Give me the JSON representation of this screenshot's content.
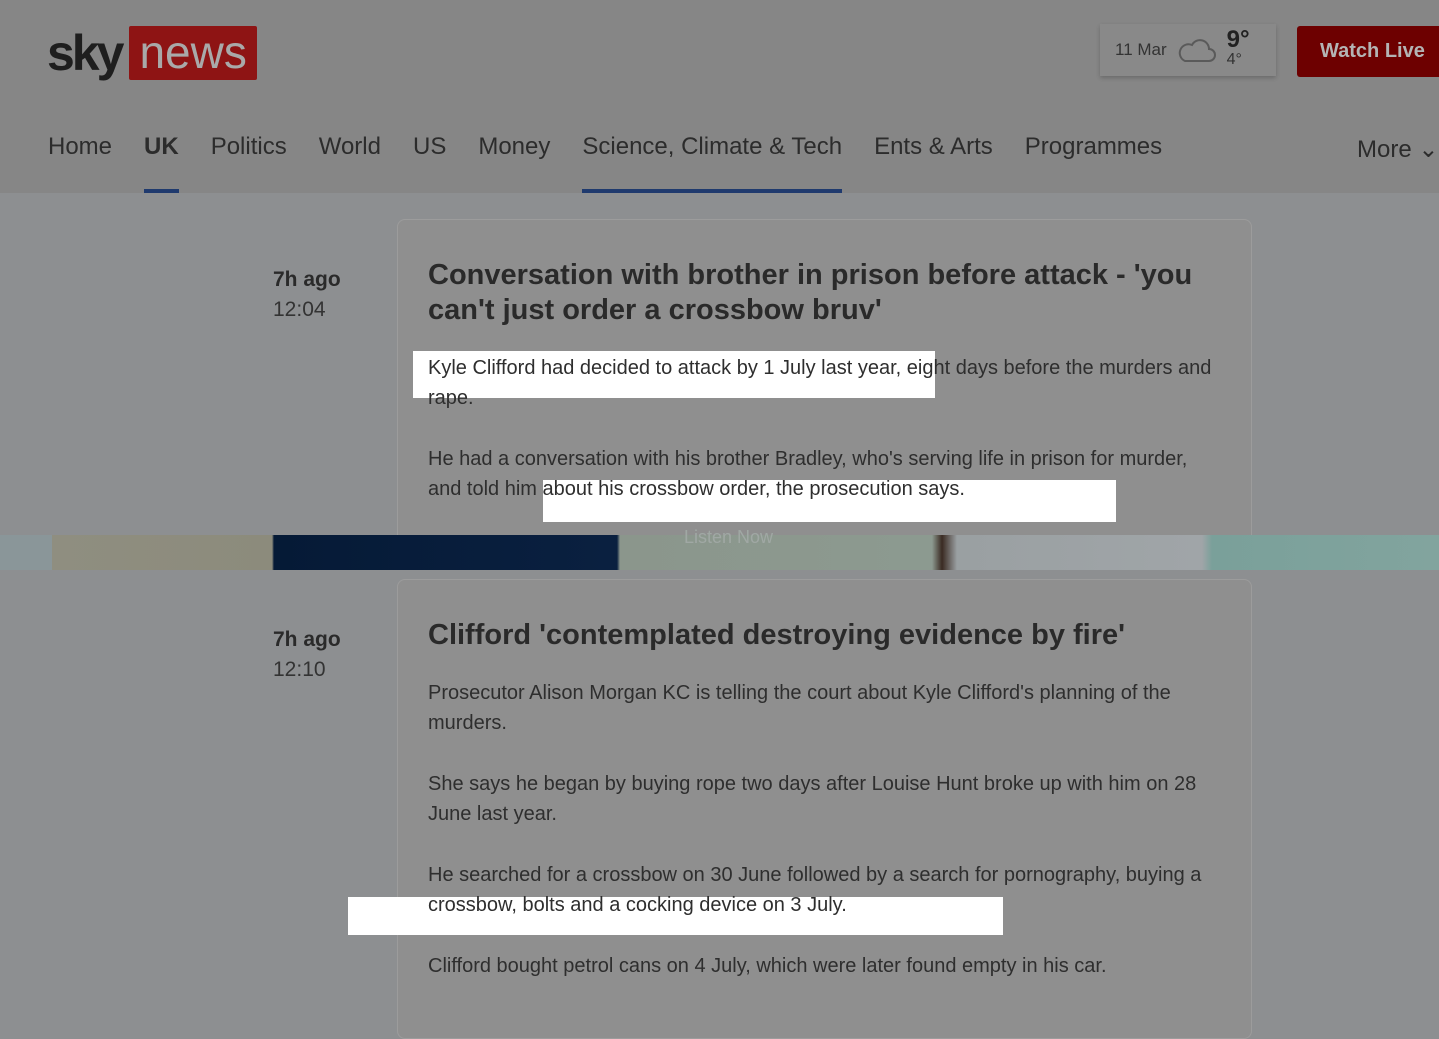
{
  "header": {
    "logo_sky": "sky",
    "logo_news": "news",
    "weather": {
      "date": "11 Mar",
      "icon": "cloud-icon",
      "high": "9°",
      "low": "4°"
    },
    "watch_live": "Watch Live"
  },
  "nav": {
    "items": [
      {
        "label": "Home"
      },
      {
        "label": "UK",
        "active": true
      },
      {
        "label": "Politics"
      },
      {
        "label": "World"
      },
      {
        "label": "US"
      },
      {
        "label": "Money"
      },
      {
        "label": "Science, Climate & Tech",
        "underlined": true
      },
      {
        "label": "Ents & Arts"
      },
      {
        "label": "Programmes"
      }
    ],
    "more": "More"
  },
  "banner": {
    "listen": "Listen Now"
  },
  "entries": [
    {
      "ago": "7h ago",
      "time": "12:04",
      "title": "Conversation with brother in prison before attack - 'you can't just order a crossbow bruv'",
      "paragraphs": [
        "Kyle Clifford had decided to attack by 1 July last year, eight days before the murders and rape.",
        "He had a conversation with his brother Bradley, who's serving life in prison for murder, and told him about his crossbow order, the prosecution says."
      ]
    },
    {
      "ago": "7h ago",
      "time": "12:10",
      "title": "Clifford 'contemplated destroying evidence by fire'",
      "paragraphs": [
        "Prosecutor Alison Morgan KC is telling the court about Kyle Clifford's planning of the murders.",
        "She says he began by buying rope two days after Louise Hunt broke up with him on 28 June last year.",
        "He searched for a crossbow on 30 June followed by a search for pornography, buying a crossbow, bolts and a cocking device on 3 July.",
        "Clifford bought petrol cans on 4 July, which were later found empty in his car."
      ]
    }
  ],
  "colors": {
    "brand_red": "#c00000",
    "nav_underline": "#1f3a6e",
    "highlight": "#ffffff"
  }
}
